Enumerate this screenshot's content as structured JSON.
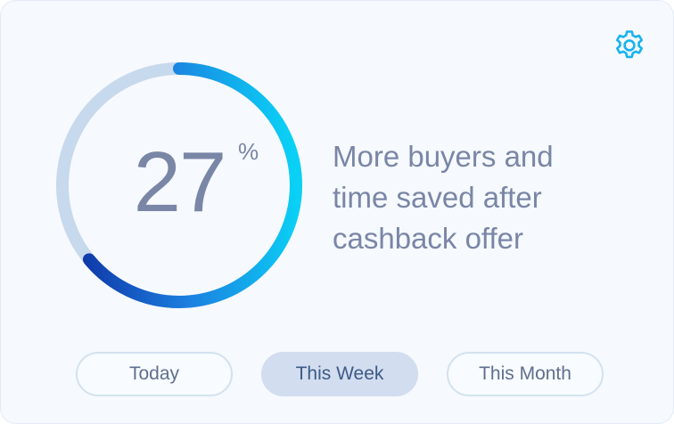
{
  "widget": {
    "stat_value": "27",
    "stat_unit": "%",
    "progress_fraction": 0.64,
    "description_lines": [
      "More buyers and",
      "time saved after",
      "cashback offer"
    ]
  },
  "tabs": [
    {
      "label": "Today",
      "active": false
    },
    {
      "label": "This Week",
      "active": true
    },
    {
      "label": "This Month",
      "active": false
    }
  ],
  "icons": {
    "settings": "gear-icon"
  },
  "colors": {
    "accent": "#17b3ee",
    "track": "#c7d9ec",
    "gradient_start": "#0d2ea0",
    "gradient_mid": "#1c7fe0",
    "gradient_end": "#0ad0f5",
    "text": "#7a86a6",
    "active_tab_bg": "#d2ddef"
  }
}
